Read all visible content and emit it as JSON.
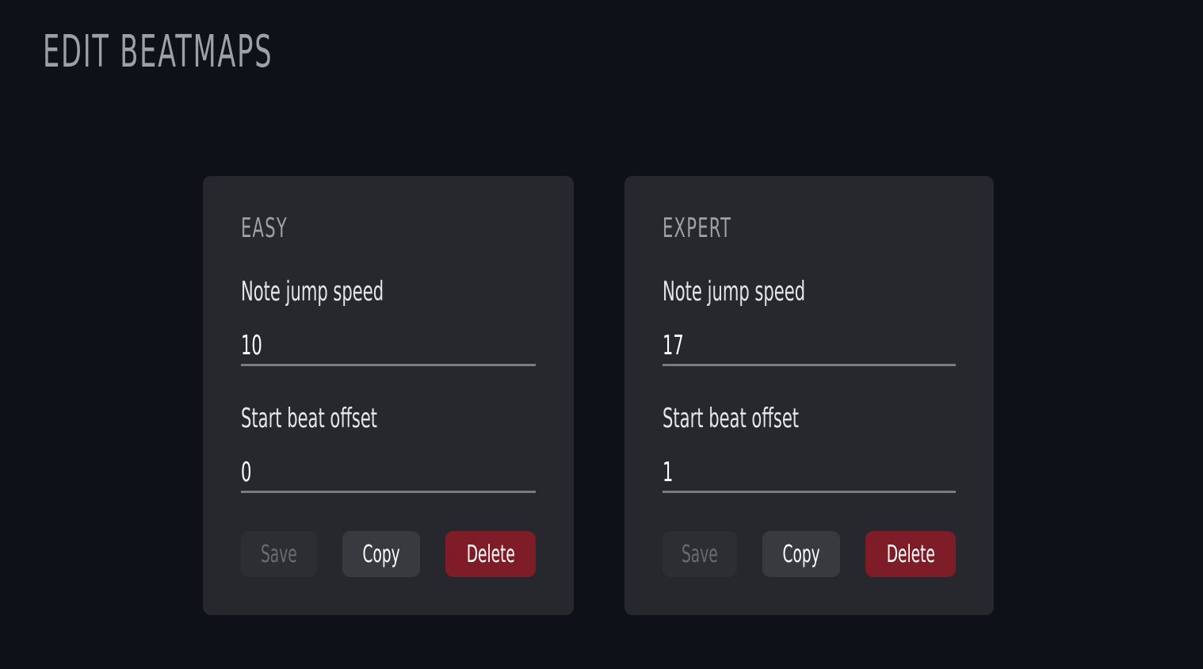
{
  "page": {
    "title": "EDIT BEATMAPS"
  },
  "beatmaps": [
    {
      "difficulty": "EASY",
      "note_jump_speed_label": "Note jump speed",
      "note_jump_speed": "10",
      "start_beat_offset_label": "Start beat offset",
      "start_beat_offset": "0",
      "buttons": {
        "save": "Save",
        "copy": "Copy",
        "delete": "Delete"
      }
    },
    {
      "difficulty": "EXPERT",
      "note_jump_speed_label": "Note jump speed",
      "note_jump_speed": "17",
      "start_beat_offset_label": "Start beat offset",
      "start_beat_offset": "1",
      "buttons": {
        "save": "Save",
        "copy": "Copy",
        "delete": "Delete"
      }
    }
  ],
  "colors": {
    "background": "#0e1118",
    "card": "#27282d",
    "delete_accent": "#7e1d27",
    "copy_button": "#393a40",
    "save_button_disabled": "#2d2e33"
  }
}
